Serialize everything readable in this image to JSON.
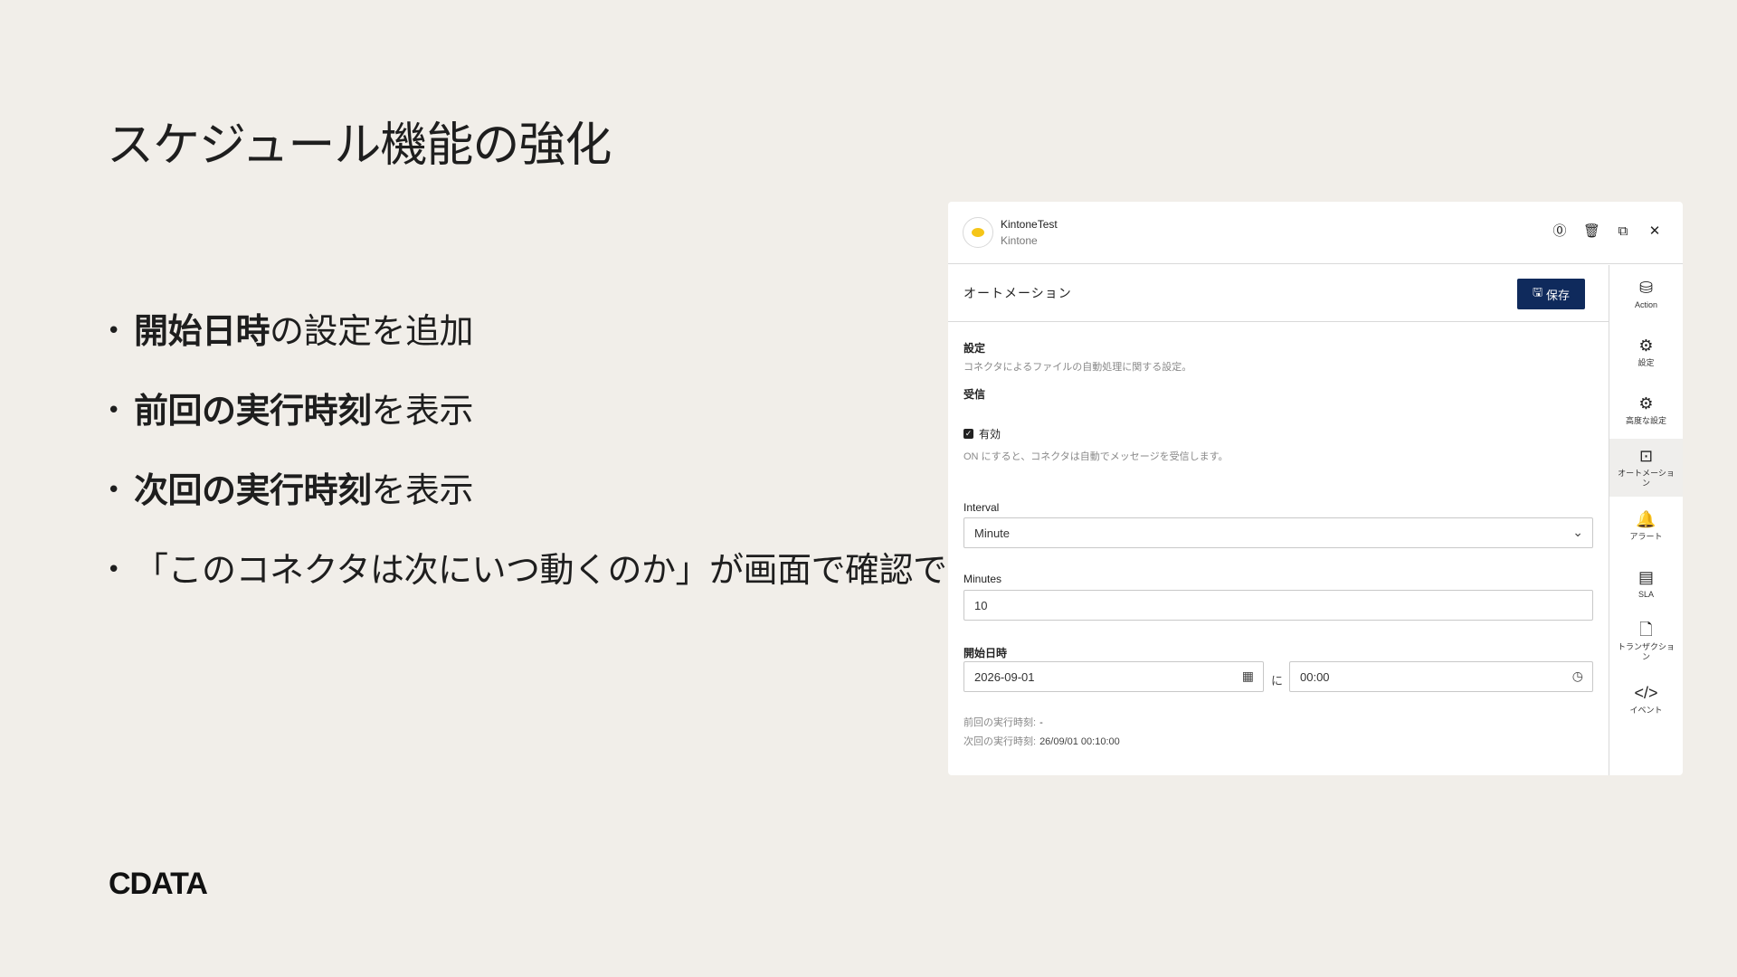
{
  "slide": {
    "title": "スケジュール機能の強化",
    "bullets": [
      {
        "bold": "開始日時",
        "rest": "の設定を追加"
      },
      {
        "bold": "前回の実行時刻",
        "rest": "を表示"
      },
      {
        "bold": "次回の実行時刻",
        "rest": "を表示"
      },
      {
        "bold": "",
        "rest": "「このコネクタは次にいつ動くのか」が画面で確認できる"
      }
    ],
    "bullet_char": "•",
    "logo": "CDATA"
  },
  "panel": {
    "connector_name": "KintoneTest",
    "connector_type": "Kintone",
    "header_icons": [
      "help-icon",
      "trash-icon",
      "external-link-icon",
      "close-icon"
    ],
    "section_title": "オートメーション",
    "save_label": "保存",
    "settings_label": "設定",
    "settings_desc": "コネクタによるファイルの自動処理に関する設定。",
    "receive_label": "受信",
    "enabled_label": "有効",
    "enabled_checked": true,
    "enabled_desc": "ON にすると、コネクタは自動でメッセージを受信します。",
    "interval_label": "Interval",
    "interval_value": "Minute",
    "minutes_label": "Minutes",
    "minutes_value": "10",
    "start_label": "開始日時",
    "start_date": "2026-09-01",
    "at_label": "に",
    "start_time": "00:00",
    "prev_run_label": "前回の実行時刻:",
    "prev_run_value": "-",
    "next_run_label": "次回の実行時刻:",
    "next_run_value": "26/09/01 00:10:00"
  },
  "sidebar": {
    "items": [
      {
        "label": "Action",
        "icon": "database-icon"
      },
      {
        "label": "設定",
        "icon": "gear-icon"
      },
      {
        "label": "高度な設定",
        "icon": "gears-icon"
      },
      {
        "label": "オートメーション",
        "icon": "automation-icon",
        "active": true
      },
      {
        "label": "アラート",
        "icon": "bell-icon"
      },
      {
        "label": "SLA",
        "icon": "document-chart-icon"
      },
      {
        "label": "トランザクション",
        "icon": "file-icon"
      },
      {
        "label": "イベント",
        "icon": "code-icon"
      }
    ]
  }
}
